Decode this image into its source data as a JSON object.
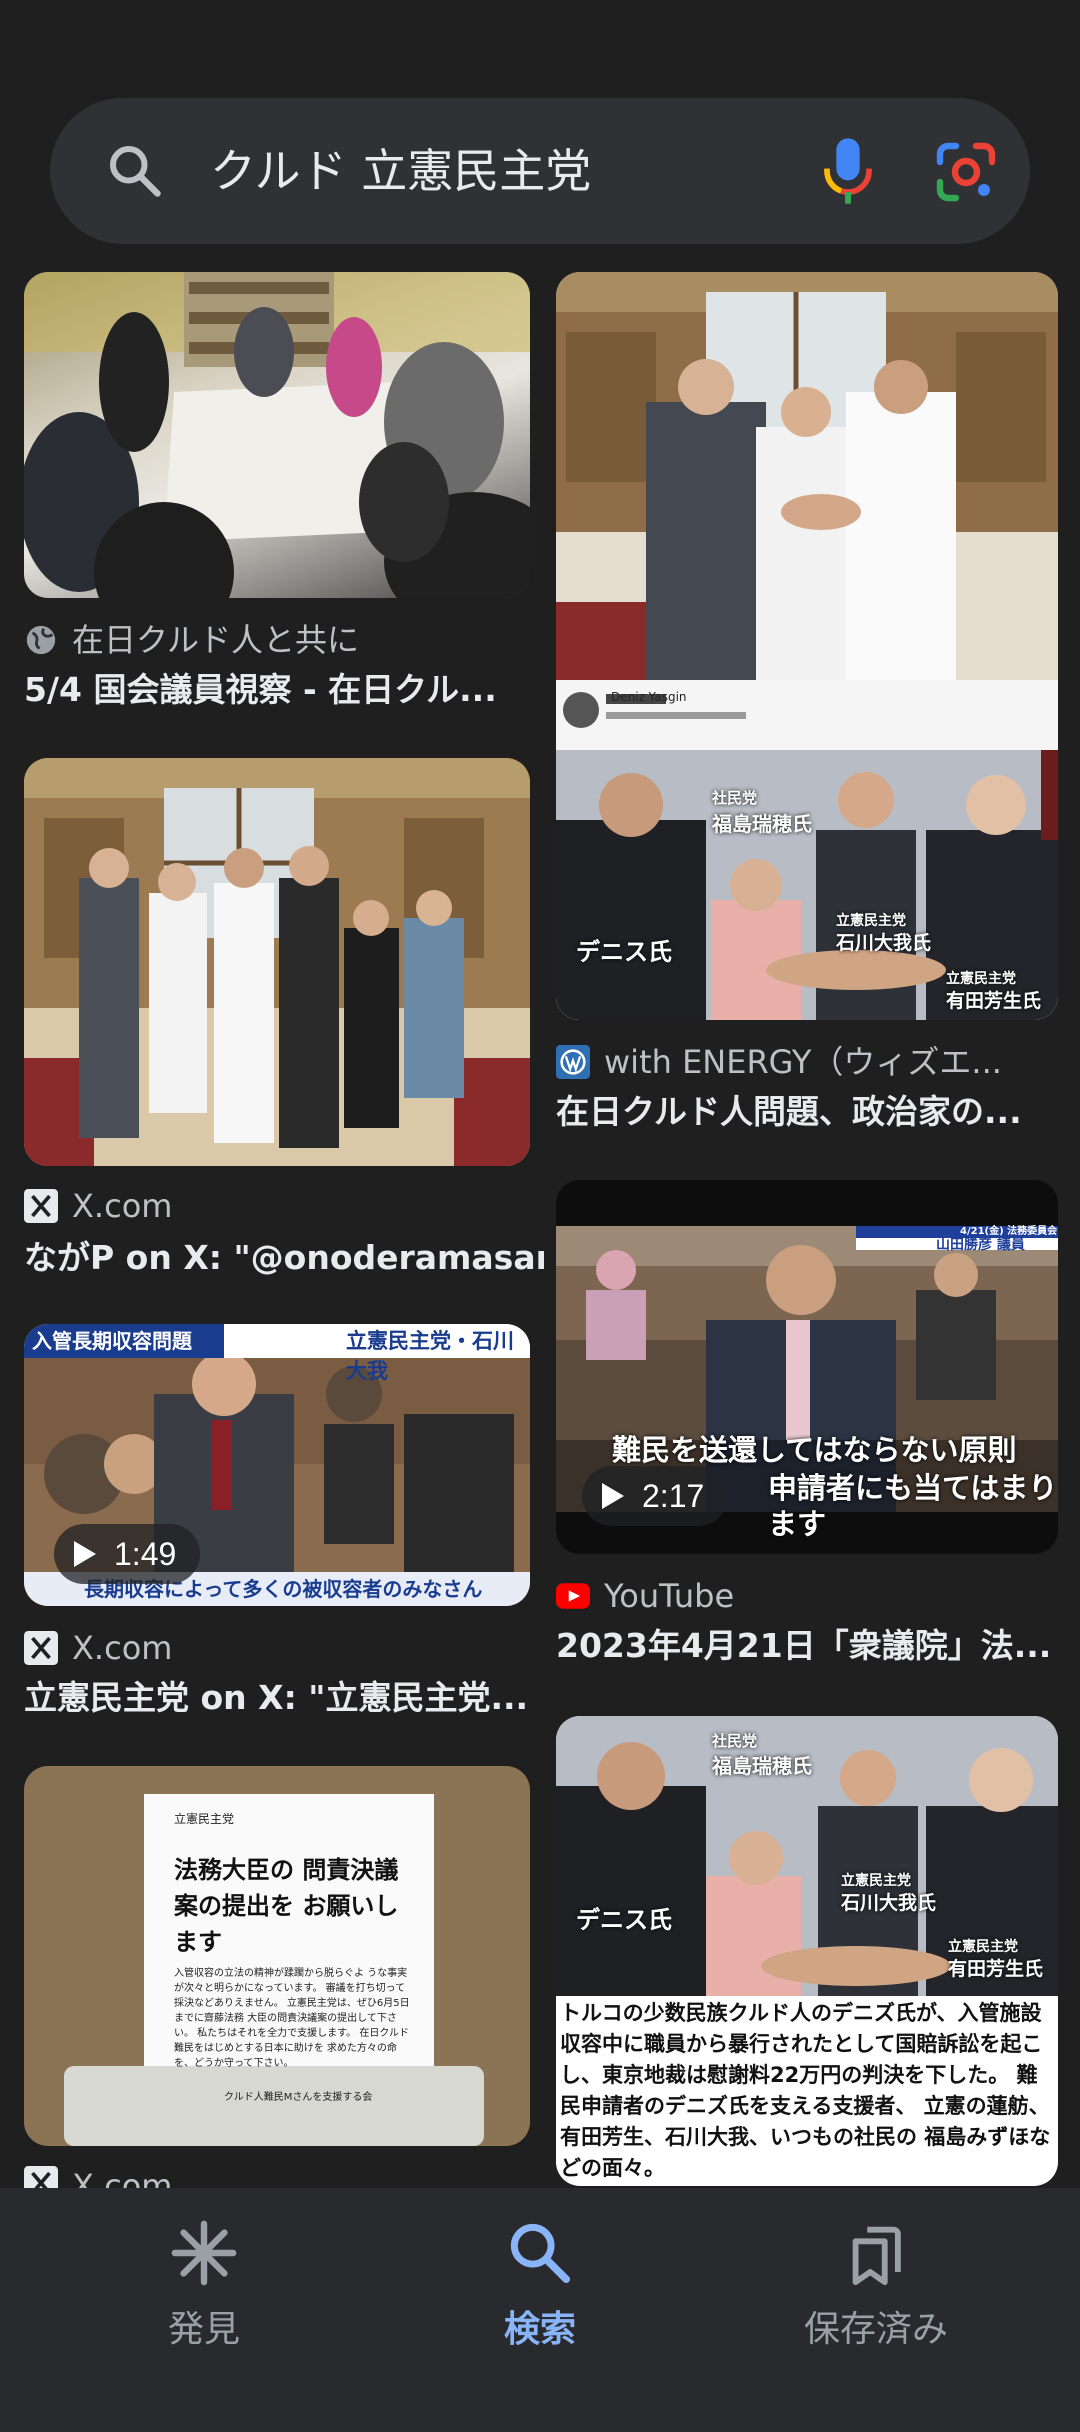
{
  "search": {
    "query": "クルド 立憲民主党"
  },
  "results": [
    {
      "source": "在日クルド人と共に",
      "title": "5/4 国会議員視察 - 在日クル..."
    },
    {
      "source": "X.com",
      "title": "ながP on X: \"@onoderamasar..."
    },
    {
      "source": "X.com",
      "title": "立憲民主党 on X: \"立憲民主党...",
      "duration": "1:49",
      "banner": "入管長期収容問題",
      "banner_right": "立憲民主党・石川大我",
      "caption": "長期収容によって多くの被収容者のみなさん"
    },
    {
      "source": "X.com",
      "doc_party": "立憲民主党",
      "doc_title": "法務大臣の 問責決議案の提出を お願いします",
      "doc_body": "入管収容の立法の精神が蹂躙から脱らぐよ うな事実が次々と明らかになっています。 審議を打ち切って採決などありえません。 立憲民主党は、ぜひ6月5日までに齋藤法務 大臣の問責決議案の提出して下さい。 私たちはそれを全力で支援します。 在日クルド難民をはじめとする日本に助けを 求めた方々の命を、どうか守って下さい。",
      "doc_sign": "クルド人難民Mさんを支援する会"
    },
    {
      "source": "with ENERGY（ウィズエ...",
      "title": "在日クルド人問題、政治家の...",
      "poster": "Deniz Yasgin",
      "labels": [
        "社民党",
        "福島瑞穂氏",
        "デニス氏",
        "立憲民主党",
        "石川大我氏",
        "立憲民主党",
        "有田芳生氏"
      ]
    },
    {
      "source": "YouTube",
      "title": "2023年4月21日「衆議院」法...",
      "duration": "2:17",
      "banner_right": "4/21(金) 法務委員会",
      "name_tag": "山田勝彦 議員",
      "subtitle_1": "難民を送還してはならない原則",
      "subtitle_2": "申請者にも当てはまります"
    },
    {
      "source": "",
      "labels": [
        "社民党",
        "福島瑞穂氏",
        "デニス氏",
        "立憲民主党",
        "石川大我氏",
        "立憲民主党",
        "有田芳生氏"
      ],
      "caption": "トルコの少数民族クルド人のデニズ氏が、入管施設 収容中に職員から暴行されたとして国賠訴訟を起こ し、東京地裁は慰謝料22万円の判決を下した。 難民申請者のデニズ氏を支える支援者、 立憲の蓮舫、有田芳生、石川大我、いつもの社民の 福島みずほなどの面々。"
    }
  ],
  "nav": {
    "discover": "発見",
    "search": "検索",
    "saved": "保存済み",
    "active_color": "#8ab4f8",
    "inactive_color": "#9aa0a6"
  },
  "colors": {
    "background": "#1f1f1f",
    "search_bar": "#303134",
    "nav_bar": "#292a2d"
  }
}
